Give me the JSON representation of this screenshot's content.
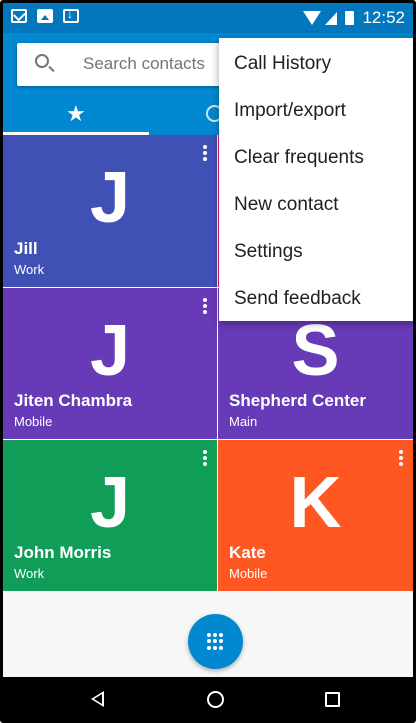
{
  "status_bar": {
    "time": "12:52",
    "icons": [
      "mail-notification-icon",
      "image-notification-icon",
      "download-notification-icon",
      "wifi-icon",
      "signal-icon",
      "battery-icon"
    ]
  },
  "search": {
    "placeholder": "Search contacts"
  },
  "tabs": [
    {
      "icon": "star-icon",
      "name": "favorites",
      "selected": true
    },
    {
      "icon": "clock-icon",
      "name": "recents",
      "selected": false
    }
  ],
  "menu": {
    "items": [
      {
        "label": "Call History"
      },
      {
        "label": "Import/export"
      },
      {
        "label": "Clear frequents"
      },
      {
        "label": "New contact"
      },
      {
        "label": "Settings"
      },
      {
        "label": "Send feedback"
      }
    ]
  },
  "contacts": [
    {
      "letter": "J",
      "name": "Jill",
      "label": "Work",
      "color": "#3f51b5"
    },
    {
      "letter": "",
      "name": "",
      "label": "",
      "color": "#e91e63"
    },
    {
      "letter": "J",
      "name": "Jiten Chambra",
      "label": "Mobile",
      "color": "#673ab7"
    },
    {
      "letter": "S",
      "name": "Shepherd Center",
      "label": "Main",
      "color": "#673ab7"
    },
    {
      "letter": "J",
      "name": "John Morris",
      "label": "Work",
      "color": "#0f9d58"
    },
    {
      "letter": "K",
      "name": "Kate",
      "label": "Mobile",
      "color": "#ff5722"
    }
  ],
  "colors": {
    "primary": "#0288d1",
    "status_bar": "#0277bd",
    "fab": "#0288d1"
  },
  "nav": {
    "icons": [
      "back-icon",
      "home-icon",
      "recents-icon"
    ]
  }
}
